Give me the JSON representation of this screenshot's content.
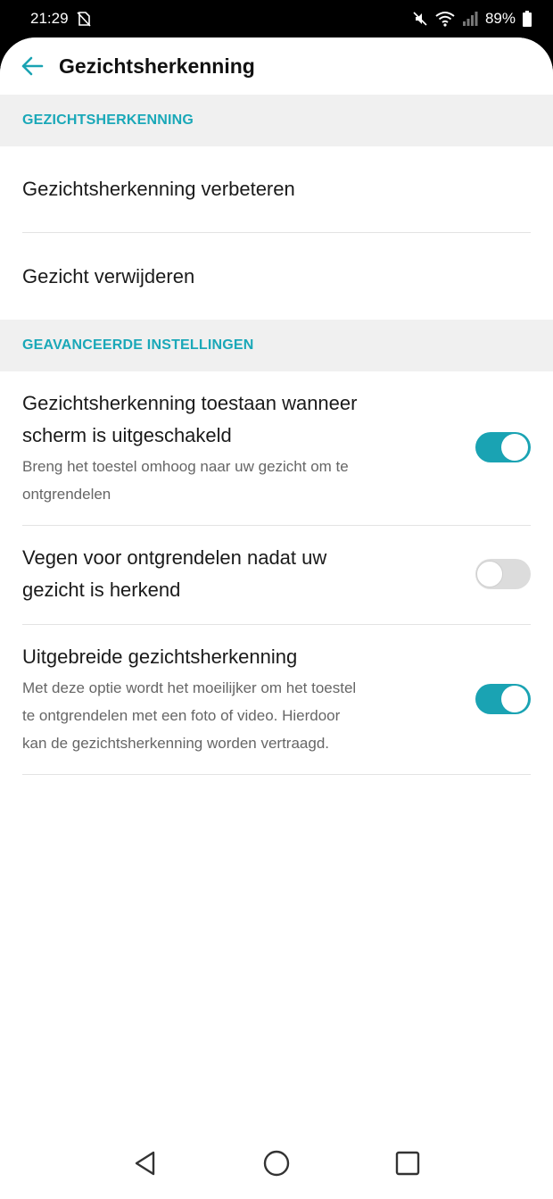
{
  "status_bar": {
    "time": "21:29",
    "battery": "89%",
    "icons": [
      "no-sim-icon",
      "mute-icon",
      "wifi-icon",
      "signal-icon",
      "battery-icon"
    ]
  },
  "app_bar": {
    "back_icon": "back-arrow-icon",
    "title": "Gezichtsherkenning"
  },
  "sections": [
    {
      "header": "GEZICHTSHERKENNING",
      "items": [
        {
          "title": "Gezichtsherkenning verbeteren"
        },
        {
          "title": "Gezicht verwijderen"
        }
      ]
    },
    {
      "header": "GEAVANCEERDE INSTELLINGEN",
      "items": [
        {
          "title_line1": "Gezichtsherkenning toestaan wanneer",
          "title_line2": "scherm is uitgeschakeld",
          "sub_line1": "Breng het toestel omhoog naar uw gezicht om te",
          "sub_line2": "ontgrendelen",
          "toggle": true
        },
        {
          "title_line1": "Vegen voor ontgrendelen nadat uw",
          "title_line2": "gezicht is herkend",
          "toggle": false
        },
        {
          "title_line1": "Uitgebreide gezichtsherkenning",
          "sub_line1": "Met deze optie wordt het moeilijker om het toestel",
          "sub_line2": "te ontgrendelen met een foto of video. Hierdoor",
          "sub_line3": "kan de gezichtsherkenning worden vertraagd.",
          "toggle": true
        }
      ]
    }
  ],
  "colors": {
    "accent": "#1aa3b3",
    "section_header_text": "#1aa8b8",
    "section_header_bg": "#f0f0f0",
    "toggle_off": "#dcdcdc"
  },
  "nav_bar": {
    "icons": [
      "back-triangle-icon",
      "home-circle-icon",
      "recents-square-icon"
    ]
  }
}
